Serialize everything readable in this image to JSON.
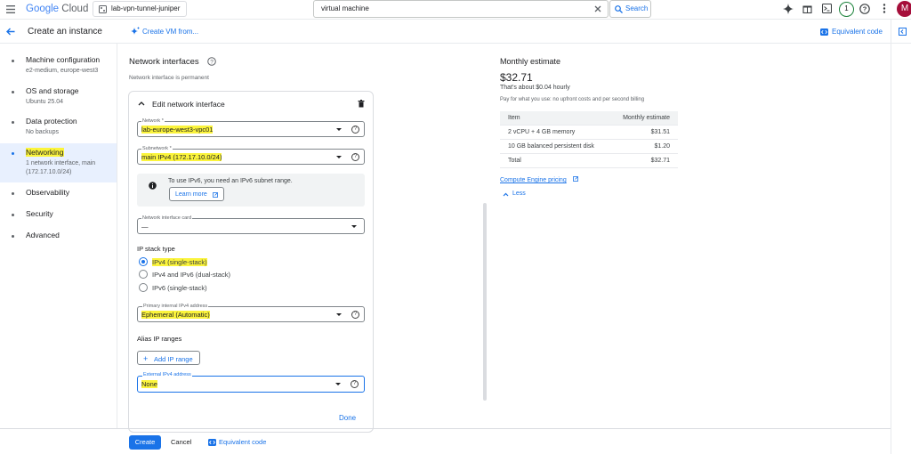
{
  "topbar": {
    "logo_google": "Google",
    "logo_cloud": "Cloud",
    "project": "lab-vpn-tunnel-juniper",
    "search_value": "virtual machine",
    "search_button": "Search",
    "notification_count": "1",
    "avatar_initial": "M"
  },
  "header": {
    "title": "Create an instance",
    "create_vm_from": "Create VM from...",
    "equivalent_code": "Equivalent code"
  },
  "nav": {
    "items": [
      {
        "label": "Machine configuration",
        "sub": "e2-medium, europe-west3"
      },
      {
        "label": "OS and storage",
        "sub": "Ubuntu 25.04"
      },
      {
        "label": "Data protection",
        "sub": "No backups"
      },
      {
        "label": "Networking",
        "sub": "1 network interface, main (172.17.10.0/24)"
      },
      {
        "label": "Observability",
        "sub": ""
      },
      {
        "label": "Security",
        "sub": ""
      },
      {
        "label": "Advanced",
        "sub": ""
      }
    ]
  },
  "form": {
    "section_title": "Network interfaces",
    "section_note": "Network interface is permanent",
    "card_title": "Edit network interface",
    "network_label": "Network *",
    "network_value": "lab-europe-west3-vpc01",
    "subnetwork_label": "Subnetwork *",
    "subnetwork_value": "main IPv4 (172.17.10.0/24)",
    "ipv6_info": "To use IPv6, you need an IPv6 subnet range.",
    "learn_more": "Learn more",
    "nic_label": "Network interface card",
    "nic_value": "—",
    "ip_stack_title": "IP stack type",
    "ip_stack_options": [
      "IPv4 (single-stack)",
      "IPv4 and IPv6 (dual-stack)",
      "IPv6 (single-stack)"
    ],
    "primary_ipv4_label": "Primary internal IPv4 address",
    "primary_ipv4_value": "Ephemeral (Automatic)",
    "alias_title": "Alias IP ranges",
    "add_ip_range": "Add IP range",
    "external_label": "External IPv4 address",
    "external_value": "None",
    "done": "Done"
  },
  "estimate": {
    "title": "Monthly estimate",
    "price": "$32.71",
    "hourly": "That's about $0.04 hourly",
    "note": "Pay for what you use: no upfront costs and per second billing",
    "col_item": "Item",
    "col_estimate": "Monthly estimate",
    "rows": [
      {
        "item": "2 vCPU + 4 GB memory",
        "cost": "$31.51"
      },
      {
        "item": "10 GB balanced persistent disk",
        "cost": "$1.20"
      },
      {
        "item": "Total",
        "cost": "$32.71"
      }
    ],
    "pricing_link": "Compute Engine pricing",
    "less": "Less"
  },
  "footer": {
    "create": "Create",
    "cancel": "Cancel",
    "equivalent_code": "Equivalent code"
  },
  "colors": {
    "accent": "#1a73e8",
    "highlight": "#fbf43c",
    "avatar": "#a50e3a"
  }
}
